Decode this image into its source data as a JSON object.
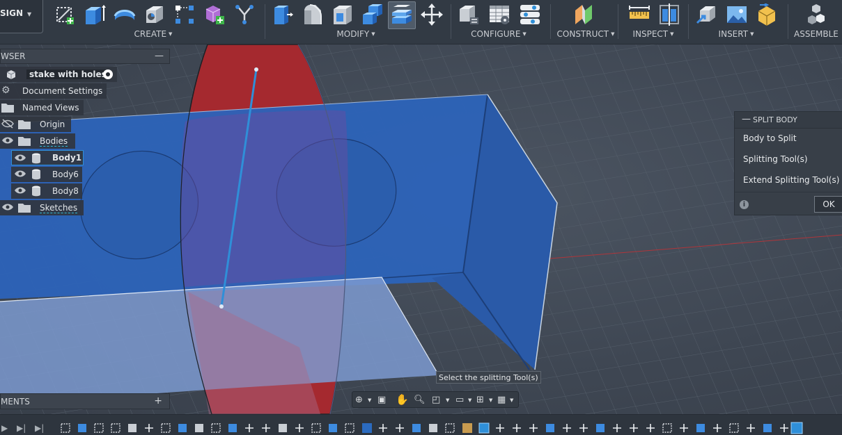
{
  "workspace": {
    "label": "SIGN"
  },
  "toolbar": {
    "groups": [
      {
        "label": "CREATE"
      },
      {
        "label": "MODIFY"
      },
      {
        "label": "CONFIGURE"
      },
      {
        "label": "CONSTRUCT"
      },
      {
        "label": "INSPECT"
      },
      {
        "label": "INSERT"
      },
      {
        "label": "ASSEMBLE"
      }
    ]
  },
  "browser": {
    "title": "WSER",
    "items": [
      {
        "label": "stake with holes"
      },
      {
        "label": "Document Settings"
      },
      {
        "label": "Named Views"
      },
      {
        "label": "Origin"
      },
      {
        "label": "Bodies"
      },
      {
        "label": "Body1"
      },
      {
        "label": "Body6"
      },
      {
        "label": "Body8"
      },
      {
        "label": "Sketches"
      }
    ]
  },
  "split_body": {
    "title": "SPLIT BODY",
    "rows": [
      {
        "label": "Body to Split"
      },
      {
        "label": "Splitting Tool(s)"
      },
      {
        "label": "Extend Splitting Tool(s)"
      }
    ],
    "ok_label": "OK"
  },
  "tooltip": "Select the splitting Tool(s)",
  "comments": {
    "title": "MENTS"
  },
  "colors": {
    "body_blue": "#2d63b8",
    "split_plane": "#a5292f",
    "toolbar_bg": "#323a44",
    "selection": "#2f8fd8"
  },
  "icons": {
    "toolbar": [
      "create-sketch-icon",
      "box-icon",
      "extrude-icon",
      "revolve-icon",
      "rectangle-pattern-icon",
      "form-icon",
      "derive-icon",
      "press-pull-icon",
      "fillet-icon",
      "shell-icon",
      "combine-icon",
      "split-body-icon",
      "move-icon",
      "configure-table-icon",
      "parameters-icon",
      "rule-icon",
      "construct-plane-icon",
      "measure-icon",
      "section-analysis-icon",
      "insert-derive-icon",
      "insert-canvas-icon",
      "insert-mesh-icon",
      "assemble-joint-icon"
    ]
  }
}
